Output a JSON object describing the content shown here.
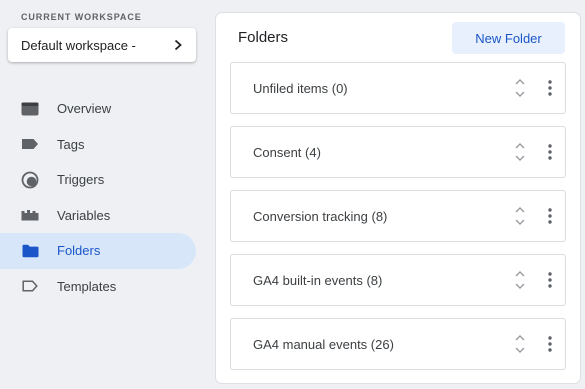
{
  "workspace": {
    "label": "CURRENT WORKSPACE",
    "name": "Default workspace -"
  },
  "nav": {
    "items": [
      {
        "label": "Overview",
        "icon": "overview-icon"
      },
      {
        "label": "Tags",
        "icon": "tag-icon"
      },
      {
        "label": "Triggers",
        "icon": "trigger-icon"
      },
      {
        "label": "Variables",
        "icon": "variables-icon"
      },
      {
        "label": "Folders",
        "icon": "folder-icon",
        "active": true
      },
      {
        "label": "Templates",
        "icon": "template-icon"
      }
    ]
  },
  "main": {
    "title": "Folders",
    "new_folder_label": "New Folder",
    "folders": [
      {
        "name": "Unfiled items (0)"
      },
      {
        "name": "Consent (4)"
      },
      {
        "name": "Conversion tracking (8)"
      },
      {
        "name": "GA4 built-in events (8)"
      },
      {
        "name": "GA4 manual events (26)"
      }
    ]
  },
  "colors": {
    "accent": "#1a56c8",
    "active_nav_bg": "#d8e6fa",
    "button_bg": "#e8f0fe",
    "page_bg": "#eef0f3"
  }
}
